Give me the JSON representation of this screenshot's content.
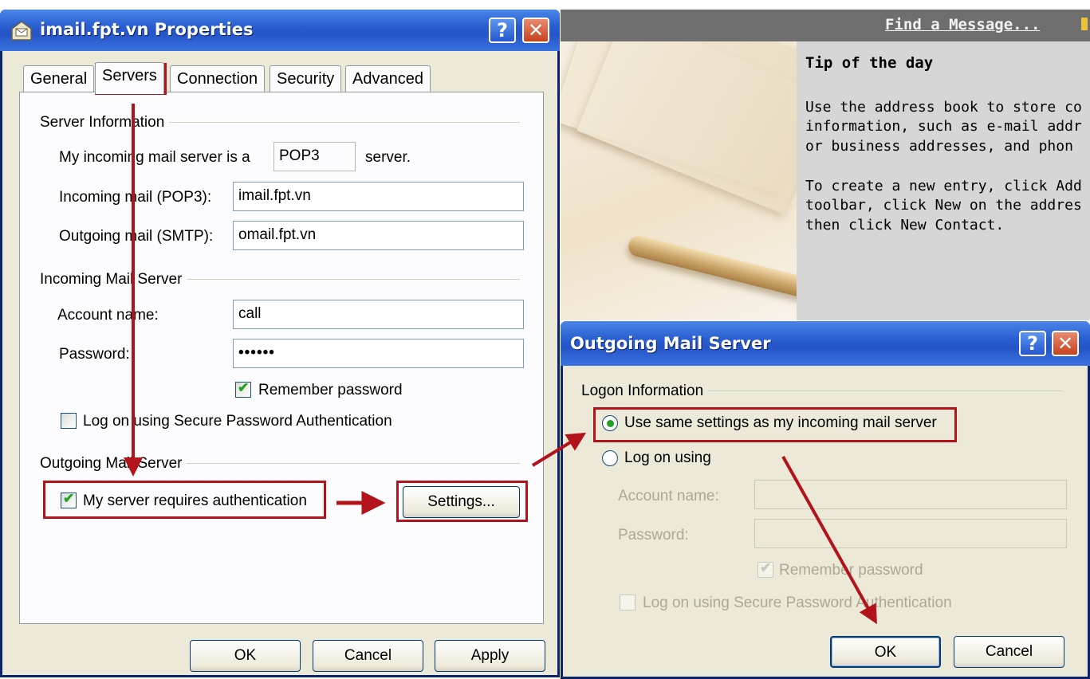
{
  "props_window": {
    "title": "imail.fpt.vn Properties",
    "help_button": "?",
    "close_button": "✕",
    "tabs": [
      "General",
      "Servers",
      "Connection",
      "Security",
      "Advanced"
    ],
    "active_tab": "Servers",
    "server_info": {
      "heading": "Server Information",
      "incoming_type_prefix": "My incoming mail server is a",
      "incoming_type_value": "POP3",
      "incoming_type_suffix": "server.",
      "incoming_label": "Incoming mail (POP3):",
      "incoming_value": "imail.fpt.vn",
      "outgoing_label": "Outgoing mail (SMTP):",
      "outgoing_value": "omail.fpt.vn"
    },
    "incoming_server": {
      "heading": "Incoming Mail Server",
      "account_label": "Account name:",
      "account_value": "call",
      "password_label": "Password:",
      "password_value": "••••••",
      "remember_label": "Remember password",
      "remember_checked": true,
      "spa_label": "Log on using Secure Password Authentication",
      "spa_checked": false
    },
    "outgoing_server": {
      "heading": "Outgoing Mail Server",
      "auth_label": "My server requires authentication",
      "auth_checked": true,
      "settings_button": "Settings..."
    },
    "buttons": {
      "ok": "OK",
      "cancel": "Cancel",
      "apply": "Apply"
    }
  },
  "background_panel": {
    "find_message": "Find a Message...",
    "tip_title": "Tip of the day",
    "tip_lines": [
      "Use the address book to store co",
      "information, such as e-mail addr",
      "or business addresses, and phon"
    ],
    "tip_lines_2": [
      "To create a new entry, click Add",
      "toolbar, click New on the addres",
      "then click New Contact."
    ]
  },
  "outgoing_dialog": {
    "title": "Outgoing Mail Server",
    "help_button": "?",
    "close_button": "✕",
    "logon_heading": "Logon Information",
    "option_same": "Use same settings as my incoming mail server",
    "option_same_selected": true,
    "option_logon": "Log on using",
    "account_label": "Account name:",
    "account_value": "",
    "password_label": "Password:",
    "password_value": "",
    "remember_label": "Remember password",
    "remember_checked": true,
    "spa_label": "Log on using Secure Password Authentication",
    "buttons": {
      "ok": "OK",
      "cancel": "Cancel"
    }
  },
  "annotation_color": "#b3131b"
}
